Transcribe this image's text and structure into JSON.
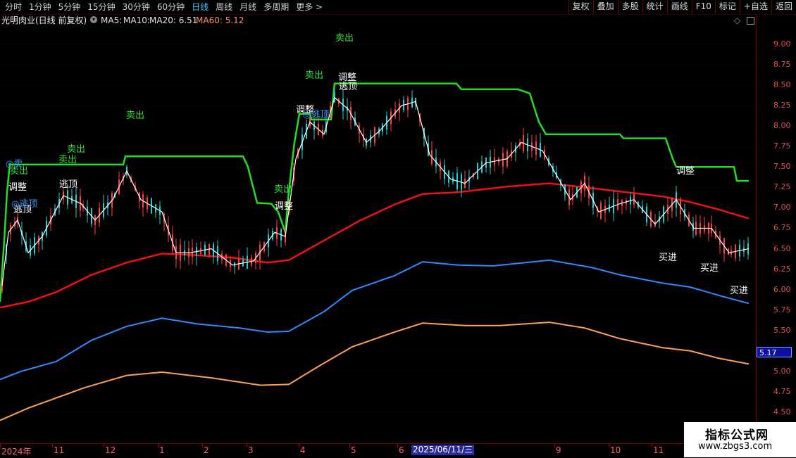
{
  "toolbar": {
    "periods": [
      "分时",
      "1分钟",
      "5分钟",
      "15分钟",
      "30分钟",
      "60分钟",
      "日线",
      "周线",
      "月线",
      "多周期",
      "更多 >"
    ],
    "active_period": "日线",
    "right_buttons": [
      "复权",
      "叠加",
      "多股",
      "统计",
      "画线",
      "F10",
      "标记",
      "+自选",
      "返回"
    ]
  },
  "infobar": {
    "stock_name": "光明肉业(日线 前复权)",
    "ma5": "MA5:",
    "ma10": "MA10:",
    "ma20": "MA20: 6.51",
    "ma60": "MA60: 5.12"
  },
  "price_axis": {
    "ticks": [
      "9.00",
      "8.75",
      "8.50",
      "8.25",
      "8.00",
      "7.75",
      "7.50",
      "7.25",
      "7.00",
      "6.75",
      "6.50",
      "6.25",
      "6.00",
      "5.75",
      "5.50",
      "5.25",
      "5.00",
      "4.75",
      "4.50"
    ],
    "current_badge": "5.17"
  },
  "time_axis": {
    "labels": [
      "2024年",
      "11",
      "12",
      "1",
      "2",
      "3",
      "4",
      "5",
      "6",
      "9",
      "10",
      "11"
    ],
    "cursor_date": "2025/06/11/三"
  },
  "annotations": {
    "sell": "卖出",
    "adjust": "调整",
    "escape": "逃顶",
    "buy": "买进",
    "escape_blue": "◎逃顶",
    "sell_blue": "◎卖"
  },
  "colors": {
    "upper_band": "#22dd22",
    "ma_red": "#ee1111",
    "ma_blue": "#2a8cff",
    "ma_orange": "#ffa050",
    "price_line": "#ffffff",
    "candle_up": "#ff4040",
    "candle_down": "#20d0d0",
    "grid": "#5a0000"
  },
  "watermark": {
    "title": "指标公式网",
    "url": "www.zbgs3.com"
  }
}
